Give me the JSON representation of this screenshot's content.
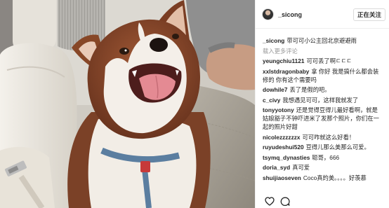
{
  "post": {
    "author": "_sicong",
    "follow_label": "正在关注",
    "caption": {
      "user": "_sicong",
      "text": "带可可小公主回北京避避雨"
    },
    "load_more": "载入更多评论"
  },
  "comments": [
    {
      "user": "yeungchiu1121",
      "text": "可可丢了啊ㄷㄷㄷ"
    },
    {
      "user": "xxlstdragonbaby",
      "text": "拿 你好 我是搞什么都会装修的 你有这个需要吗"
    },
    {
      "user": "dowhile7",
      "text": "丢了是假的吧。"
    },
    {
      "user": "c_civy",
      "text": "我想遇见可可，这样我就发了"
    },
    {
      "user": "tonyyotony",
      "text": "还是觉得豆得儿最好看啊，就是姑娘豁子不钟吓进米了发那个照片，你们在一起的照片好甜"
    },
    {
      "user": "nicolezzzzzzx",
      "text": "可可咋就这么好看！"
    },
    {
      "user": "ruyudeshui520",
      "text": "豆得儿那么美那么可爱。"
    },
    {
      "user": "tsymq_dynasties",
      "text": "聪哥，666"
    },
    {
      "user": "doria_syd",
      "text": "真可爱"
    },
    {
      "user": "shuijiaoseven",
      "text": "Coco真的美。。。。好羡慕"
    }
  ],
  "actions": {
    "like_icon": "heart-icon",
    "comment_icon": "comment-icon"
  },
  "colors": {
    "text": "#262626",
    "muted": "#999999",
    "border": "#efefef"
  }
}
